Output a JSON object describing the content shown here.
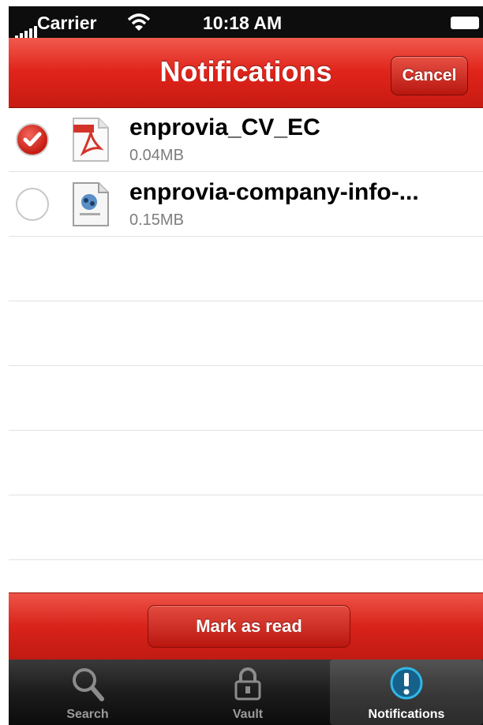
{
  "status_bar": {
    "carrier": "Carrier",
    "time": "10:18 AM"
  },
  "nav": {
    "title": "Notifications",
    "cancel_label": "Cancel"
  },
  "files": [
    {
      "name": "enprovia_CV_EC",
      "size": "0.04MB",
      "checked": true,
      "icon": "pdf-file-icon"
    },
    {
      "name": "enprovia-company-info-...",
      "size": "0.15MB",
      "checked": false,
      "icon": "document-file-icon"
    }
  ],
  "toolbar": {
    "mark_read_label": "Mark as read"
  },
  "tabs": [
    {
      "label": "Search",
      "icon": "search-icon",
      "selected": false
    },
    {
      "label": "Vault",
      "icon": "lock-icon",
      "selected": false
    },
    {
      "label": "Notifications",
      "icon": "exclamation-icon",
      "selected": true
    }
  ],
  "colors": {
    "accent_red": "#d8231a",
    "tab_highlight": "#2fb8e8"
  }
}
